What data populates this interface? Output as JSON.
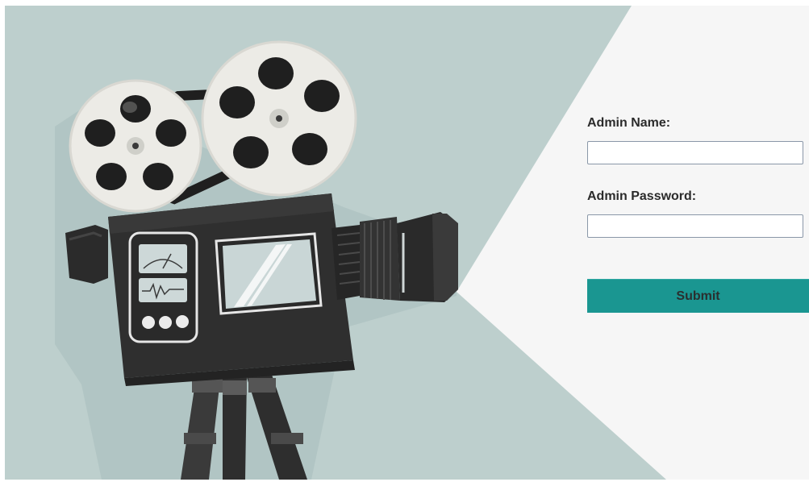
{
  "login_form": {
    "admin_name_label": "Admin Name:",
    "admin_name_value": "",
    "admin_password_label": "Admin Password:",
    "admin_password_value": "",
    "submit_label": "Submit"
  },
  "illustration": {
    "subject": "movie-camera",
    "colors": {
      "background_panel": "#bdcfcd",
      "form_panel": "#f6f6f6",
      "camera_body": "#2e2e2e",
      "reels": "#ecebe6",
      "accent_teal": "#1a9691"
    }
  }
}
